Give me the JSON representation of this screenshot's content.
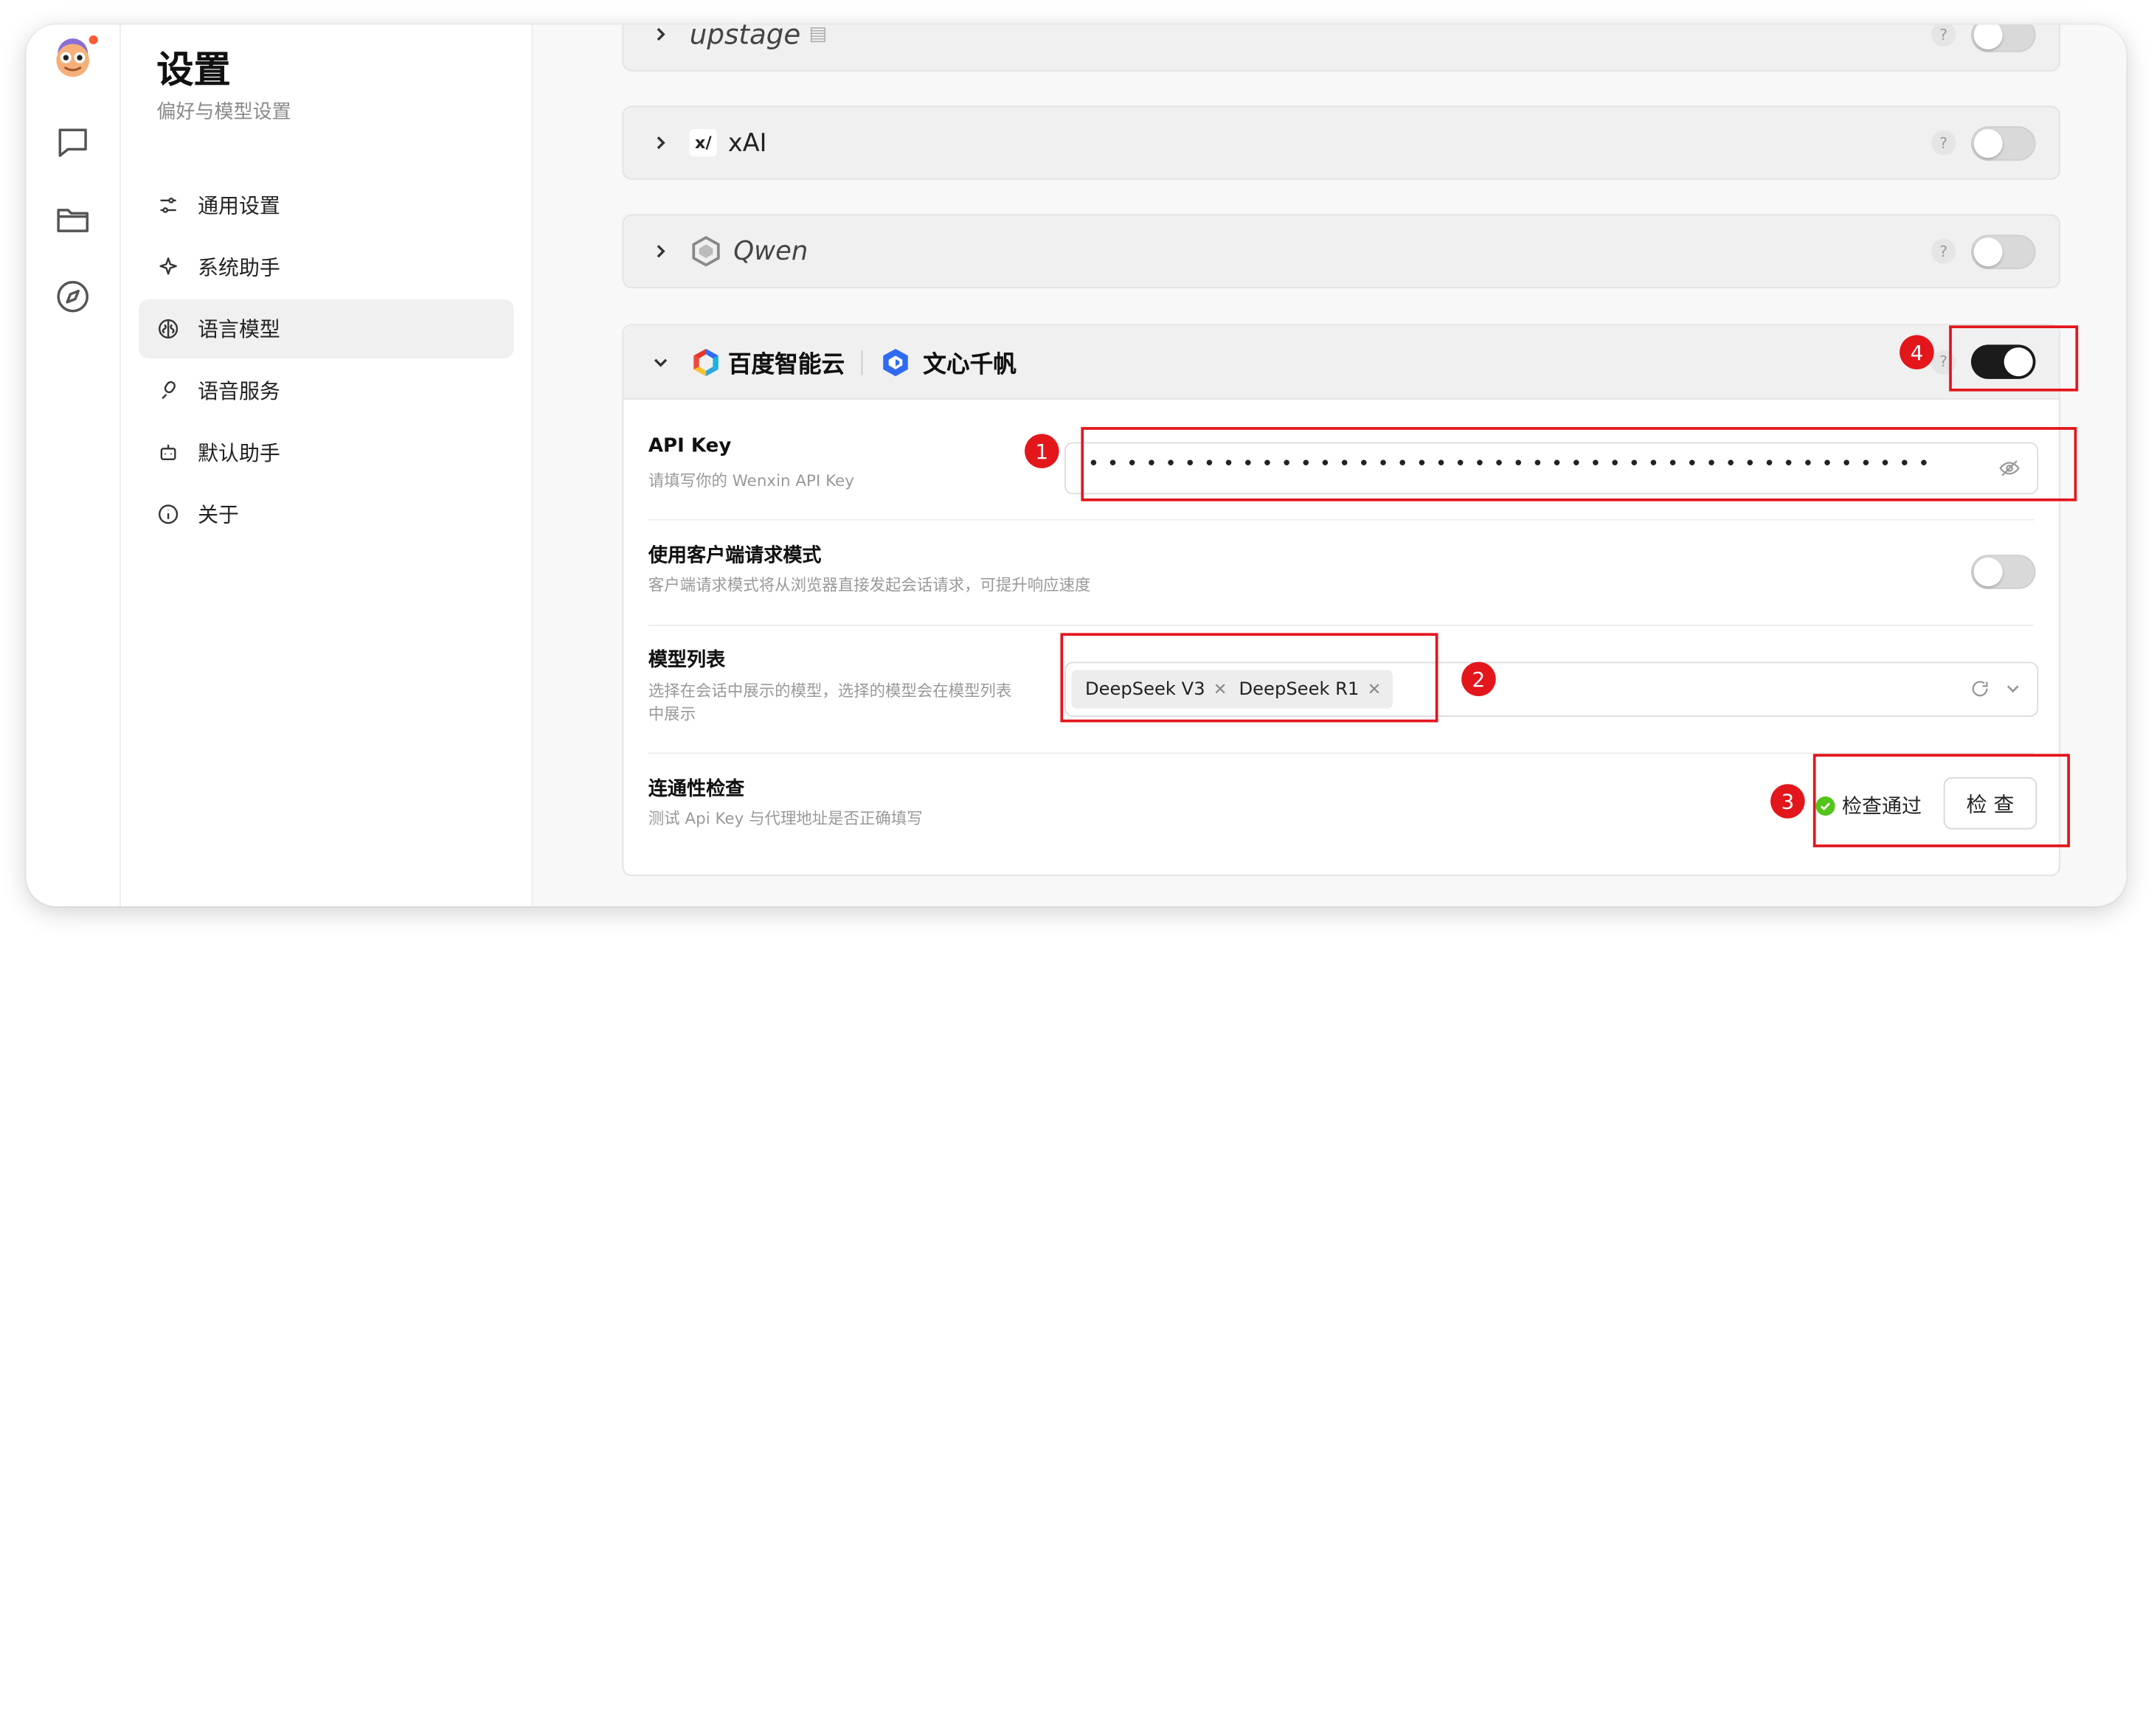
{
  "settings": {
    "title": "设置",
    "subtitle": "偏好与模型设置"
  },
  "nav": {
    "items": [
      {
        "label": "通用设置",
        "icon": "sliders-icon"
      },
      {
        "label": "系统助手",
        "icon": "sparkle-icon"
      },
      {
        "label": "语言模型",
        "icon": "brain-icon",
        "active": true
      },
      {
        "label": "语音服务",
        "icon": "microphone-icon"
      },
      {
        "label": "默认助手",
        "icon": "robot-icon"
      },
      {
        "label": "关于",
        "icon": "info-icon"
      }
    ]
  },
  "providers": {
    "upstage": {
      "name": "upstage",
      "enabled": false,
      "help": "?"
    },
    "xai": {
      "name": "xAI",
      "enabled": false,
      "help": "?"
    },
    "qwen": {
      "name": "Qwen",
      "enabled": false,
      "help": "?"
    },
    "wenxin": {
      "brand_baidu": "百度智能云",
      "brand_wenxin": "文心千帆",
      "enabled": true,
      "help": "?",
      "api_key": {
        "title": "API Key",
        "desc": "请填写你的 Wenxin API Key",
        "value": "••••••••••••••••••••••••••••••••••••••••••••"
      },
      "client_mode": {
        "title": "使用客户端请求模式",
        "desc": "客户端请求模式将从浏览器直接发起会话请求，可提升响应速度",
        "enabled": false
      },
      "model_list": {
        "title": "模型列表",
        "desc": "选择在会话中展示的模型，选择的模型会在模型列表中展示",
        "tags": [
          "DeepSeek V3",
          "DeepSeek R1"
        ]
      },
      "connectivity": {
        "title": "连通性检查",
        "desc": "测试 Api Key 与代理地址是否正确填写",
        "status": "检查通过",
        "button": "检 查"
      }
    }
  },
  "annotations": [
    "1",
    "2",
    "3",
    "4"
  ],
  "colors": {
    "highlight": "#e3161c",
    "success": "#52c41a",
    "switch_on": "#1b1b1b"
  }
}
